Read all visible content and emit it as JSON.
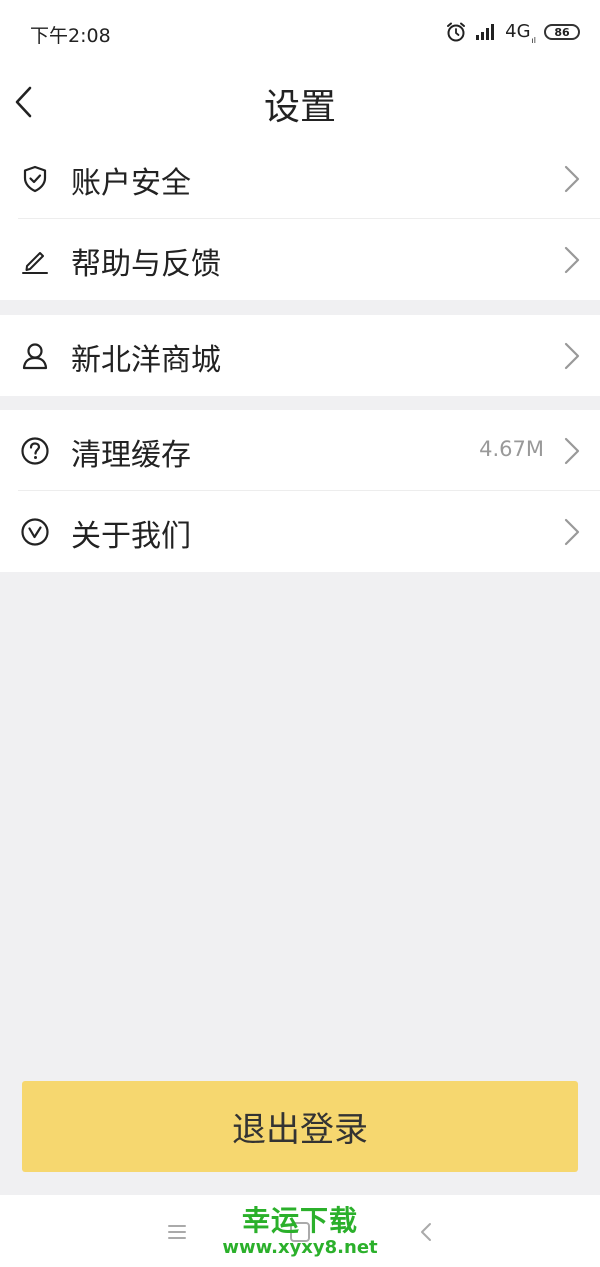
{
  "status_bar": {
    "time": "下午2:08",
    "network": "4G",
    "network_sub": "ıl",
    "battery": "86"
  },
  "header": {
    "title": "设置"
  },
  "groups": [
    {
      "items": [
        {
          "label": "账户安全",
          "icon": "shield-check-icon"
        },
        {
          "label": "帮助与反馈",
          "icon": "pencil-icon"
        }
      ]
    },
    {
      "items": [
        {
          "label": "新北洋商城",
          "icon": "person-icon"
        }
      ]
    },
    {
      "items": [
        {
          "label": "清理缓存",
          "icon": "question-circle-icon",
          "value": "4.67M"
        },
        {
          "label": "关于我们",
          "icon": "check-circle-icon"
        }
      ]
    }
  ],
  "logout": {
    "label": "退出登录"
  },
  "watermark": {
    "title": "幸运下载",
    "url": "www.xyxy8.net"
  },
  "colors": {
    "accent": "#F6D76F",
    "background": "#F0F0F2",
    "watermark": "#2BB02B"
  }
}
